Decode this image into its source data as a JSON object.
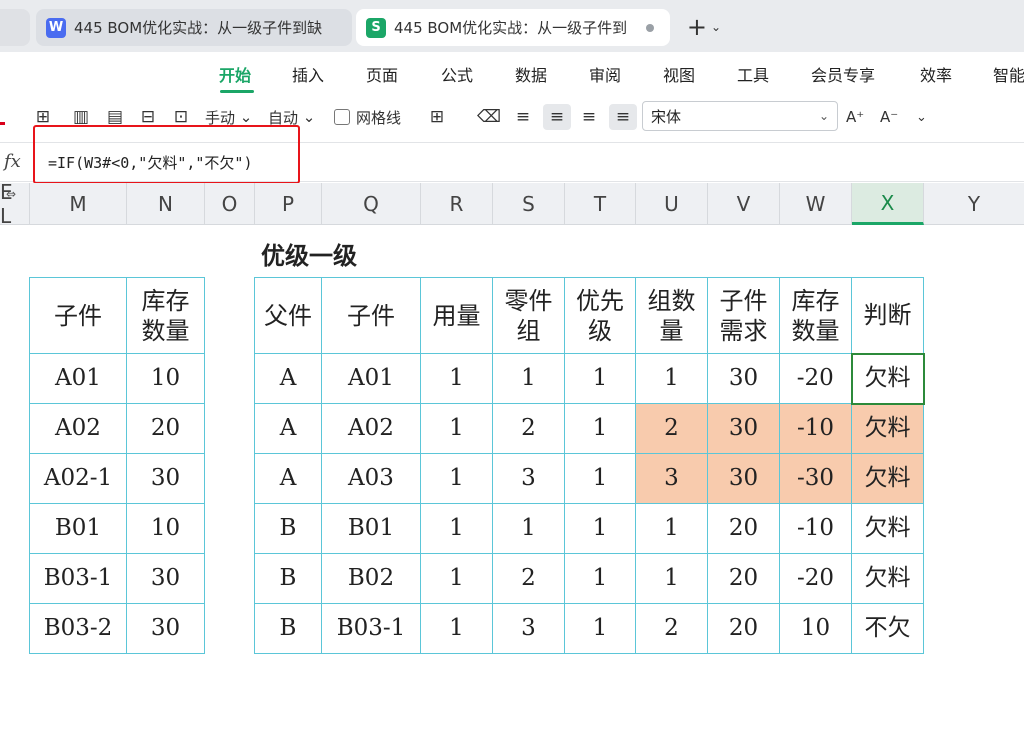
{
  "tabs": [
    {
      "app_icon": "W",
      "label": "445 BOM优化实战：从一级子件到缺"
    },
    {
      "app_icon": "S",
      "label": "445 BOM优化实战：从一级子件到"
    }
  ],
  "new_tab": {
    "plus": "+",
    "chevron": "⌄"
  },
  "menu": [
    "开始",
    "插入",
    "页面",
    "公式",
    "数据",
    "审阅",
    "视图",
    "工具",
    "会员专享",
    "效率",
    "智能"
  ],
  "toolbar": {
    "manual_label": "手动",
    "auto_label": "自动",
    "gridlines_label": "网格线",
    "font_name": "宋体",
    "font_grow": "A⁺",
    "font_shrink": "A⁻"
  },
  "formula_bar": {
    "fx_label": "fx",
    "formula": "=IF(W3#<0,\"欠料\",\"不欠\")"
  },
  "columns": [
    "E L",
    "M",
    "N",
    "O",
    "P",
    "Q",
    "R",
    "S",
    "T",
    "U",
    "V",
    "W",
    "X",
    "Y"
  ],
  "selected_column": "X",
  "sheet_title": "优级一级",
  "left_table": {
    "headers": [
      "子件",
      "库存\n数量"
    ],
    "rows": [
      [
        "A01",
        "10"
      ],
      [
        "A02",
        "20"
      ],
      [
        "A02-1",
        "30"
      ],
      [
        "B01",
        "10"
      ],
      [
        "B03-1",
        "30"
      ],
      [
        "B03-2",
        "30"
      ]
    ]
  },
  "right_table": {
    "headers": [
      "父件",
      "子件",
      "用量",
      "零件\n组",
      "优先\n级",
      "组数\n量",
      "子件\n需求",
      "库存\n数量",
      "判断"
    ],
    "rows": [
      [
        "A",
        "A01",
        "1",
        "1",
        "1",
        "1",
        "30",
        "-20",
        "欠料"
      ],
      [
        "A",
        "A02",
        "1",
        "2",
        "1",
        "2",
        "30",
        "-10",
        "欠料"
      ],
      [
        "A",
        "A03",
        "1",
        "3",
        "1",
        "3",
        "30",
        "-30",
        "欠料"
      ],
      [
        "B",
        "B01",
        "1",
        "1",
        "1",
        "1",
        "20",
        "-10",
        "欠料"
      ],
      [
        "B",
        "B02",
        "1",
        "2",
        "1",
        "1",
        "20",
        "-20",
        "欠料"
      ],
      [
        "B",
        "B03-1",
        "1",
        "3",
        "1",
        "2",
        "20",
        "10",
        "不欠"
      ]
    ],
    "highlight_color": "#f8cbad"
  },
  "colors": {
    "accent": "#1ba667",
    "formula_box": "#e8141a",
    "table_border": "#5bc6d8"
  }
}
